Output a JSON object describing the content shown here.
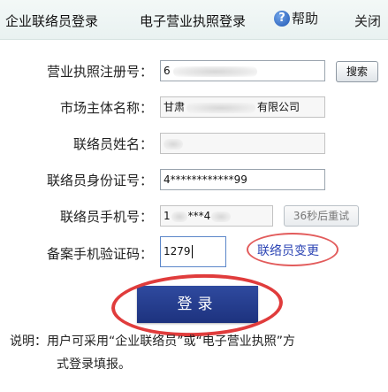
{
  "header": {
    "tab_company": "企业联络员登录",
    "tab_license": "电子营业执照登录",
    "help_icon_glyph": "?",
    "help_label": "帮助",
    "close_label": "关闭"
  },
  "form": {
    "reg_no": {
      "label": "营业执照注册号：",
      "value_prefix": "6",
      "search_label": "搜索"
    },
    "entity_name": {
      "label": "市场主体名称：",
      "value_start": "甘肃",
      "value_end": "有限公司"
    },
    "contact_name": {
      "label": "联络员姓名："
    },
    "id_number": {
      "label": "联络员身份证号：",
      "value": "4************99"
    },
    "phone": {
      "label": "联络员手机号：",
      "value_start": "1",
      "value_mid": "***4",
      "resend_label": "36秒后重试"
    },
    "sms_code": {
      "label": "备案手机验证码：",
      "value": "1279"
    },
    "contact_change_label": "联络员变更"
  },
  "login_label": "登录",
  "note": {
    "line1": "说明：用户可采用“企业联络员”或“电子营业执照”方",
    "line2": "式登录填报。"
  },
  "colors": {
    "login_button": "#233a8a",
    "annotation_red": "#e03c3c",
    "link_blue": "#2d46b5"
  }
}
